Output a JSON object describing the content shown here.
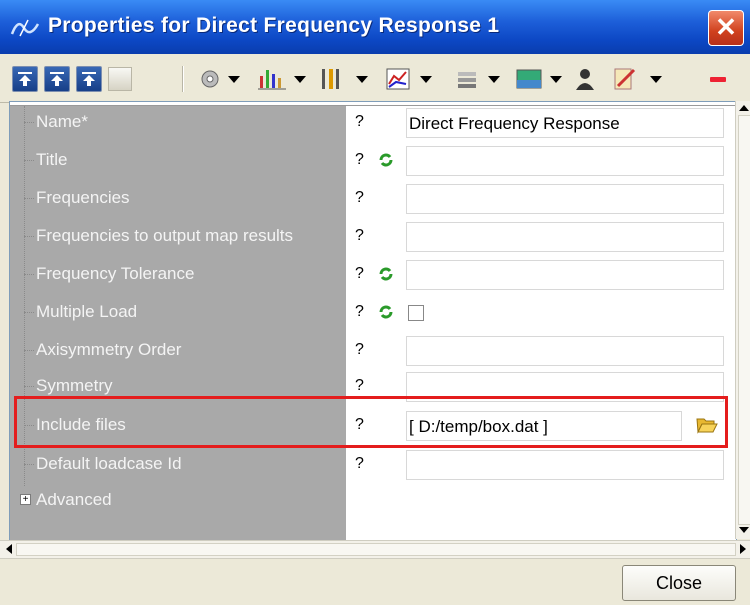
{
  "window": {
    "title": "Properties for Direct Frequency Response 1"
  },
  "rows": [
    {
      "label": "Name*",
      "q": "?",
      "value": "Direct Frequency Response"
    },
    {
      "label": "Title",
      "q": "?",
      "value": ""
    },
    {
      "label": "Frequencies",
      "q": "?",
      "value": ""
    },
    {
      "label": "Frequencies to output map results",
      "q": "?",
      "value": ""
    },
    {
      "label": "Frequency Tolerance",
      "q": "?",
      "value": ""
    },
    {
      "label": "Multiple Load",
      "q": "?",
      "checked": false
    },
    {
      "label": "Axisymmetry Order",
      "q": "?",
      "value": ""
    },
    {
      "label": "Symmetry",
      "q": "?",
      "value": ""
    },
    {
      "label": "Include files",
      "q": "?",
      "value": "[ D:/temp/box.dat ]"
    },
    {
      "label": "Default loadcase Id",
      "q": "?",
      "value": ""
    },
    {
      "label": "Advanced"
    }
  ],
  "buttons": {
    "close": "Close"
  },
  "colors": {
    "titlebar": "#1D5FD9",
    "highlight": "#E41D1D",
    "label_panel": "#A9A9A9"
  }
}
